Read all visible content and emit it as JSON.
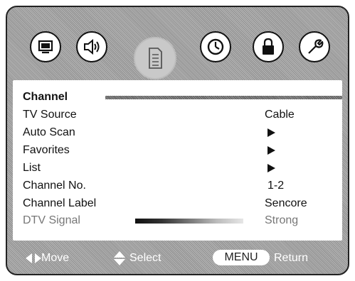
{
  "top_icons": [
    {
      "name": "picture-icon"
    },
    {
      "name": "audio-icon"
    },
    {
      "name": "channel-icon",
      "selected": true
    },
    {
      "name": "time-icon"
    },
    {
      "name": "lock-icon"
    },
    {
      "name": "setup-icon"
    }
  ],
  "menu": {
    "section_title": "Channel",
    "rows": [
      {
        "label": "TV Source",
        "value": "Cable"
      },
      {
        "label": "Auto Scan",
        "value_icon": "arrow-right-icon"
      },
      {
        "label": "Favorites",
        "value_icon": "arrow-right-icon"
      },
      {
        "label": "List",
        "value_icon": "arrow-right-icon"
      },
      {
        "label": "Channel No.",
        "value": "1-2"
      },
      {
        "label": "Channel Label",
        "value": "Sencore"
      },
      {
        "label": "DTV Signal",
        "value": "Strong",
        "disabled": true
      }
    ]
  },
  "footer": {
    "move_label": "Move",
    "select_label": "Select",
    "menu_key": "MENU",
    "return_label": "Return"
  }
}
